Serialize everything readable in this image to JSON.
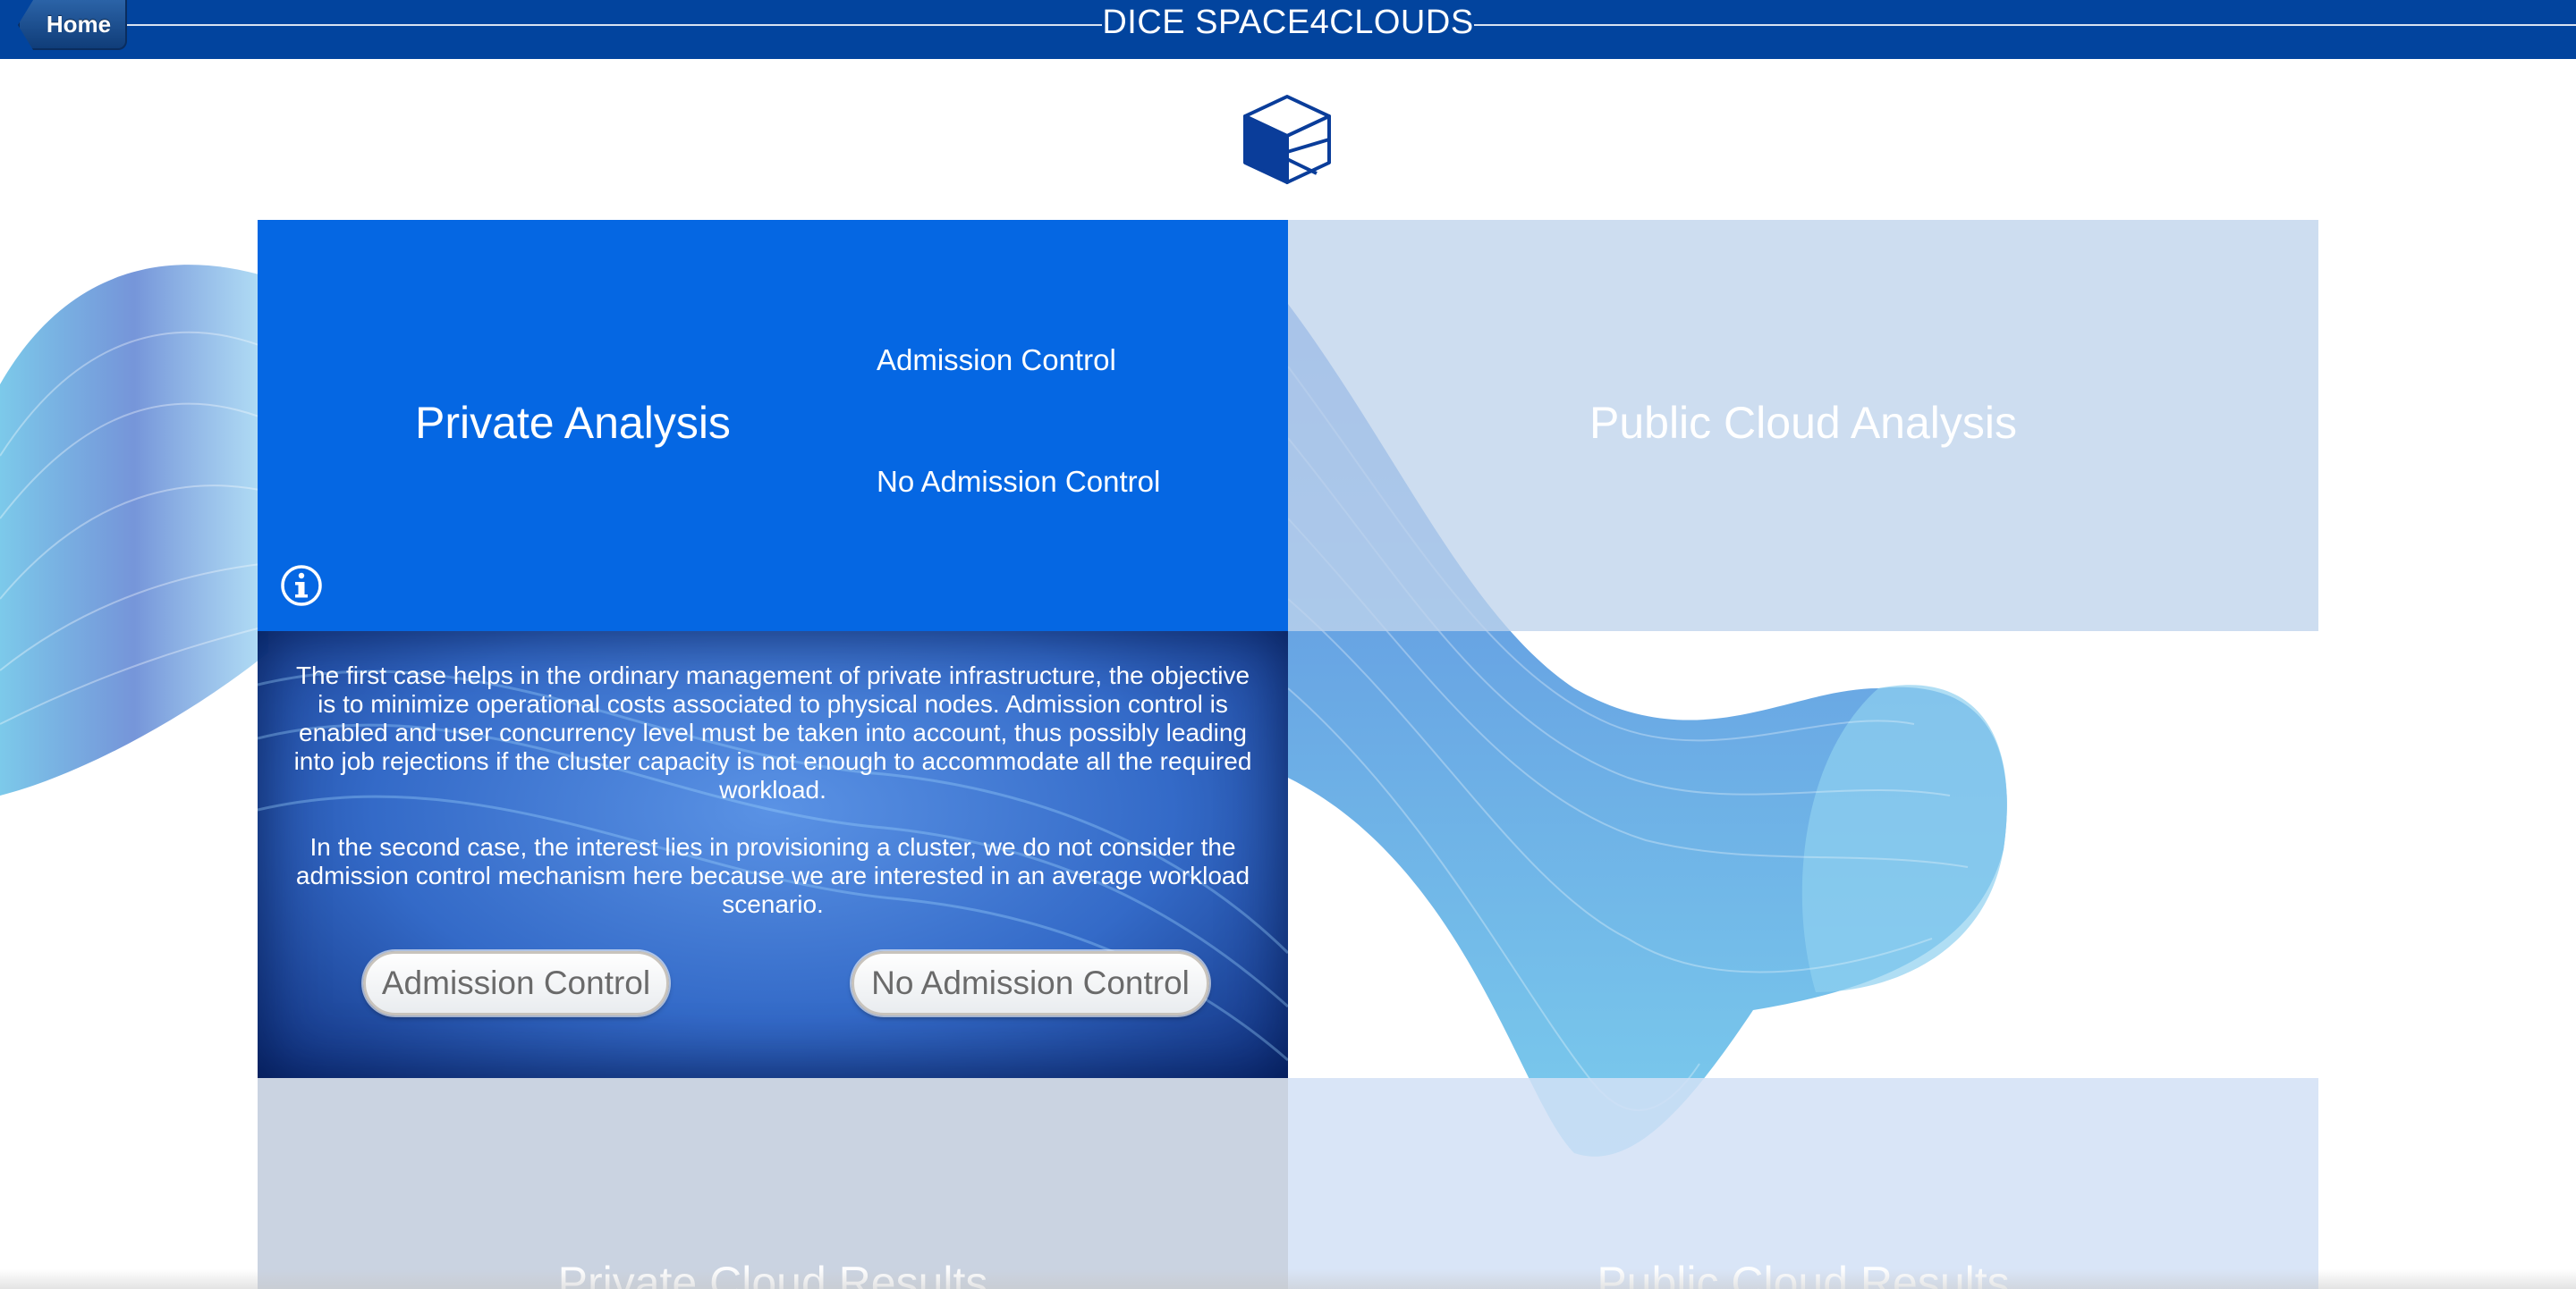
{
  "header": {
    "title": "DICE SPACE4CLOUDS",
    "home_label": "Home"
  },
  "logo": {
    "icon": "cube-icon"
  },
  "tiles": {
    "private_analysis": {
      "title": "Private Analysis",
      "links": [
        "Admission Control",
        "No Admission Control"
      ],
      "info_icon": "info-icon"
    },
    "public_cloud_analysis": {
      "title": "Public Cloud Analysis"
    },
    "private_cloud_results": {
      "title": "Private Cloud Results"
    },
    "public_cloud_results": {
      "title": "Public Cloud Results"
    }
  },
  "info_panel": {
    "paragraph1": "The first case helps in the ordinary management of private infrastructure, the objective is to minimize operational costs associated to physical nodes. Admission control is enabled and user concurrency level must be taken into account, thus possibly leading into job rejections if the cluster capacity is not enough to accommodate all the required workload.",
    "paragraph2": "In the second case, the interest lies in provisioning a cluster, we do not consider the admission control mechanism here because we are interested in an average workload scenario.",
    "buttons": {
      "admission_control": "Admission Control",
      "no_admission_control": "No Admission Control"
    }
  },
  "colors": {
    "header_bg": "#02449e",
    "private_tile": "#0567e3",
    "public_tile": "#bfd3ec",
    "wave_dark": "#1a4fc0",
    "wave_light": "#3db0e0"
  }
}
